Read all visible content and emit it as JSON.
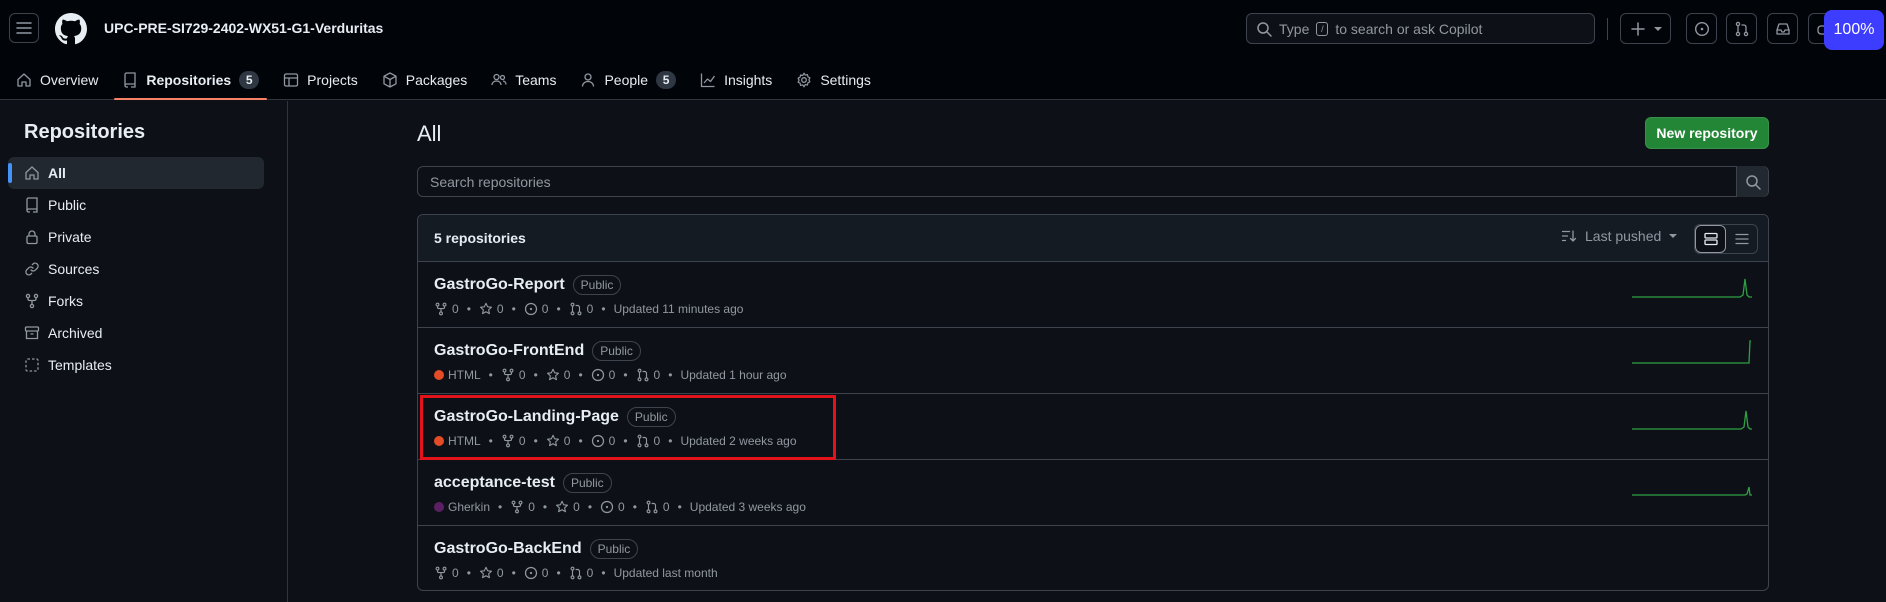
{
  "header": {
    "org_name": "UPC-PRE-SI729-2402-WX51-G1-Verduritas",
    "search_placeholder_pre": "Type",
    "search_key": "/",
    "search_placeholder_post": "to search or ask Copilot",
    "zoom": "100%"
  },
  "tabs": [
    {
      "label": "Overview",
      "icon": "home-icon"
    },
    {
      "label": "Repositories",
      "icon": "repo-icon",
      "count": "5",
      "active": true
    },
    {
      "label": "Projects",
      "icon": "table-icon"
    },
    {
      "label": "Packages",
      "icon": "package-icon"
    },
    {
      "label": "Teams",
      "icon": "people-icon"
    },
    {
      "label": "People",
      "icon": "person-icon",
      "count": "5"
    },
    {
      "label": "Insights",
      "icon": "graph-icon"
    },
    {
      "label": "Settings",
      "icon": "gear-icon"
    }
  ],
  "sidebar": {
    "title": "Repositories",
    "items": [
      {
        "label": "All",
        "icon": "home-icon",
        "active": true
      },
      {
        "label": "Public",
        "icon": "repo-icon"
      },
      {
        "label": "Private",
        "icon": "lock-icon"
      },
      {
        "label": "Sources",
        "icon": "link-icon"
      },
      {
        "label": "Forks",
        "icon": "fork-icon"
      },
      {
        "label": "Archived",
        "icon": "archive-icon"
      },
      {
        "label": "Templates",
        "icon": "template-icon"
      }
    ]
  },
  "main": {
    "title": "All",
    "new_repo_label": "New repository",
    "search_placeholder": "Search repositories",
    "count_label": "5 repositories",
    "sort_label": "Last pushed"
  },
  "repos": [
    {
      "name": "GastroGo-Report",
      "visibility": "Public",
      "language": "",
      "lang_color": "",
      "forks": "0",
      "stars": "0",
      "issues": "0",
      "prs": "0",
      "updated": "Updated 11 minutes ago"
    },
    {
      "name": "GastroGo-FrontEnd",
      "visibility": "Public",
      "language": "HTML",
      "lang_color": "#e34c26",
      "forks": "0",
      "stars": "0",
      "issues": "0",
      "prs": "0",
      "updated": "Updated 1 hour ago"
    },
    {
      "name": "GastroGo-Landing-Page",
      "visibility": "Public",
      "language": "HTML",
      "lang_color": "#e34c26",
      "forks": "0",
      "stars": "0",
      "issues": "0",
      "prs": "0",
      "updated": "Updated 2 weeks ago"
    },
    {
      "name": "acceptance-test",
      "visibility": "Public",
      "language": "Gherkin",
      "lang_color": "#5b2063",
      "forks": "0",
      "stars": "0",
      "issues": "0",
      "prs": "0",
      "updated": "Updated 3 weeks ago"
    },
    {
      "name": "GastroGo-BackEnd",
      "visibility": "Public",
      "language": "",
      "lang_color": "",
      "forks": "0",
      "stars": "0",
      "issues": "0",
      "prs": "0",
      "updated": "Updated last month"
    }
  ],
  "colors": {
    "accent": "#238636",
    "tab_underline": "#f78166",
    "sidebar_indicator": "#4493f8",
    "sparkline": "#2ea043",
    "highlight_box": "#e3131b"
  }
}
